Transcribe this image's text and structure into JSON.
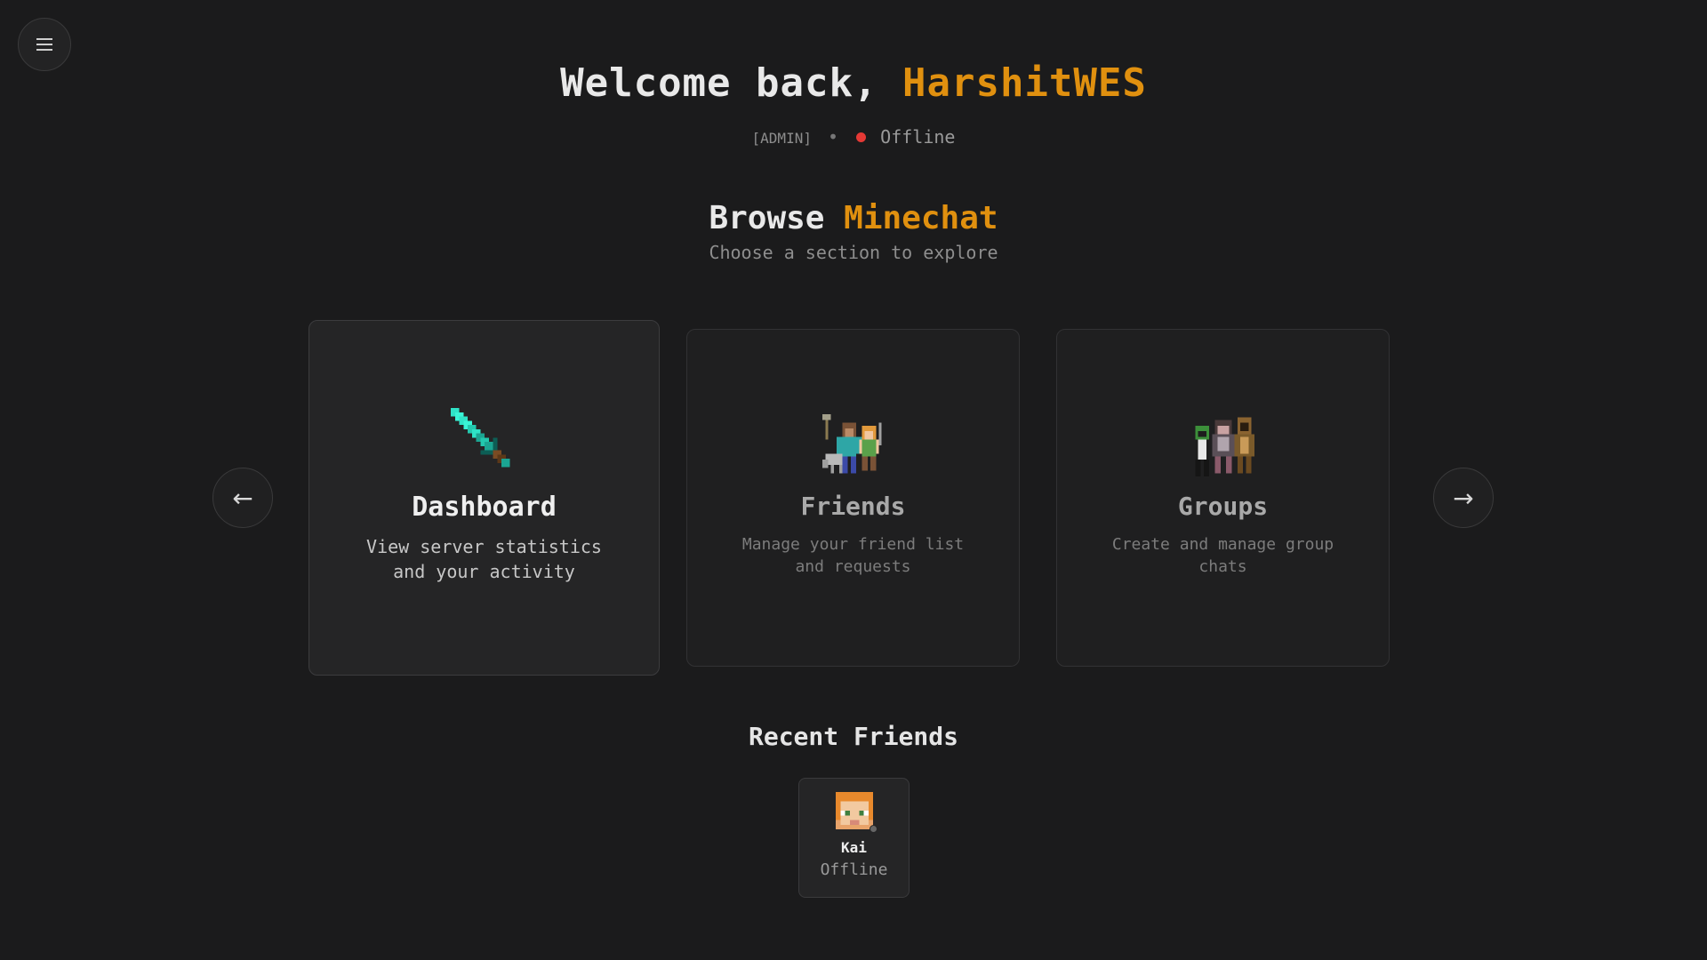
{
  "header": {
    "welcome_prefix": "Welcome back,",
    "username": "HarshitWES",
    "role": "[ADMIN]",
    "separator": "•",
    "status": "Offline"
  },
  "browse": {
    "title_prefix": "Browse",
    "title_accent": "Minechat",
    "subtitle": "Choose a section to explore"
  },
  "cards": [
    {
      "title": "Dashboard",
      "description": "View server statistics and your activity",
      "icon": "diamond-sword-icon"
    },
    {
      "title": "Friends",
      "description": "Manage your friend list and requests",
      "icon": "friends-characters-icon"
    },
    {
      "title": "Groups",
      "description": "Create and manage group chats",
      "icon": "groups-characters-icon"
    }
  ],
  "recent_friends": {
    "title": "Recent Friends",
    "items": [
      {
        "name": "Kai",
        "status": "Offline"
      }
    ]
  },
  "colors": {
    "accent": "#e0900f",
    "background": "#1b1b1c",
    "offline_dot": "#e53935"
  }
}
